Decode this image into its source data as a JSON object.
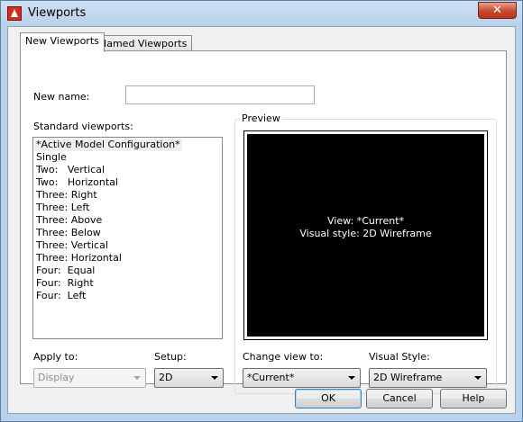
{
  "window": {
    "title": "Viewports",
    "close_glyph": "✕"
  },
  "tabs": [
    {
      "label": "New Viewports",
      "active": true
    },
    {
      "label": "Named Viewports",
      "active": false
    }
  ],
  "new_name": {
    "label": "New name:",
    "value": ""
  },
  "standard_viewports": {
    "label": "Standard viewports:",
    "items": [
      "*Active Model Configuration*",
      "Single",
      "Two:   Vertical",
      "Two:   Horizontal",
      "Three: Right",
      "Three: Left",
      "Three: Above",
      "Three: Below",
      "Three: Vertical",
      "Three: Horizontal",
      "Four:  Equal",
      "Four:  Right",
      "Four:  Left"
    ],
    "selected_index": 0
  },
  "preview": {
    "label": "Preview",
    "view_text": "View: *Current*",
    "style_text": "Visual style: 2D Wireframe"
  },
  "apply_to": {
    "label": "Apply to:",
    "value": "Display",
    "disabled": true
  },
  "setup": {
    "label": "Setup:",
    "value": "2D"
  },
  "change_view_to": {
    "label": "Change view to:",
    "value": "*Current*"
  },
  "visual_style": {
    "label": "Visual Style:",
    "value": "2D Wireframe"
  },
  "buttons": {
    "ok": "OK",
    "cancel": "Cancel",
    "help": "Help"
  },
  "colors": {
    "title_bar": "#b9d1ea",
    "close_button": "#c7492f",
    "preview_bg": "#000000",
    "dialog_bg": "#f0f0f0"
  }
}
